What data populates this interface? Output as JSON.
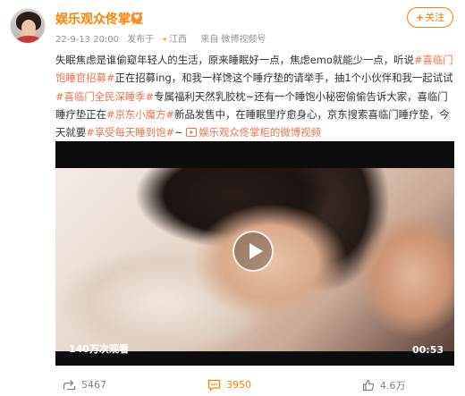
{
  "post": {
    "username": "娱乐观众佟掌柜",
    "badge": "♥",
    "meta": {
      "time": "22-9-13 20:00",
      "location_prefix": "发布于",
      "location": "江西",
      "source": "来自 微博视频号"
    },
    "follow_label": "关注",
    "content": {
      "t1": "失眠焦虑是谁偷窥年轻人的生活，原来睡眠好一点，焦虑emo就能少一点，听说",
      "tag1": "#喜临门饱睡官招募#",
      "t2": "正在招募ing，和我一样馋这个睡疗垫的请举手，抽1个小伙伴和我一起试试",
      "tag2": "#喜临门全民深睡季#",
      "t3": "专属福利天然乳胶枕~还有一个睡饱小秘密偷偷告诉大家，喜临门睡疗垫正在",
      "tag3": "#京东小魔方#",
      "t4": "新品发售中，在睡眠里疗愈身心，京东搜索喜临门睡疗垫，今天就要",
      "tag4": "#享受每天睡到饱#",
      "t5": "~ ",
      "video_link": "娱乐观众佟掌柜的微博视频"
    },
    "video": {
      "views": "140万次观看",
      "duration": "00:53"
    },
    "actions": {
      "forward_count": "5467",
      "comment_count": "3950",
      "like_count": "4.6万"
    },
    "colors": {
      "brand_orange": "#ff8200",
      "tag": "#eb7350"
    }
  }
}
